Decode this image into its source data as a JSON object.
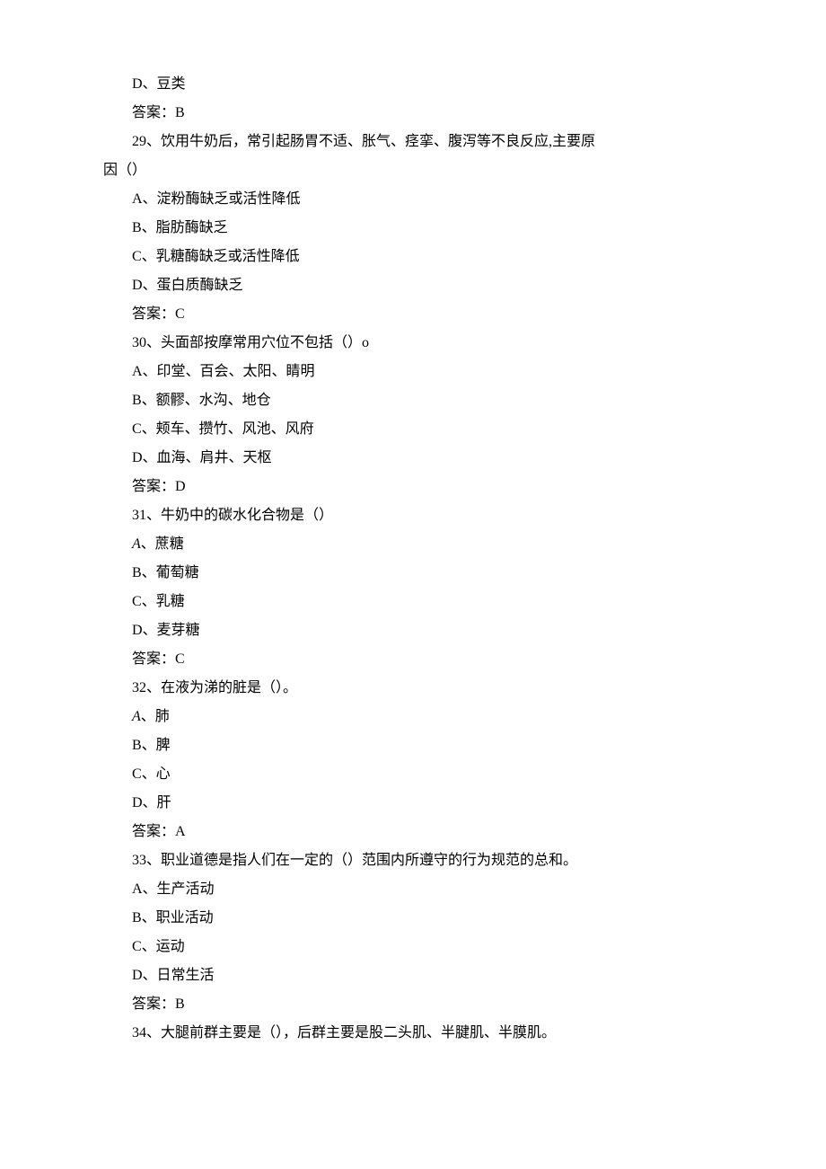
{
  "lines": [
    "D、豆类",
    "答案：B",
    "29、饮用牛奶后，常引起肠胃不适、胀气、痉挛、腹泻等不良反应,主要原因（）",
    "A、淀粉酶缺乏或活性降低",
    "B、脂肪酶缺乏",
    "C、乳糖酶缺乏或活性降低",
    "D、蛋白质酶缺乏",
    "答案：C",
    "30、头面部按摩常用穴位不包括（）o",
    "A、印堂、百会、太阳、睛明",
    "B、额髎、水沟、地仓",
    "C、颊车、攒竹、风池、风府",
    "D、血海、肩井、天枢",
    "答案：D",
    "31、牛奶中的碳水化合物是（）",
    "A、蔗糖",
    "B、葡萄糖",
    "C、乳糖",
    "D、麦芽糖",
    "答案：C",
    "32、在液为涕的脏是（）。",
    "A、肺",
    "B、脾",
    "C、心",
    "D、肝",
    "答案：A",
    "33、职业道德是指人们在一定的（）范围内所遵守的行为规范的总和。",
    "A、生产活动",
    "B、职业活动",
    "C、运动",
    "D、日常生活",
    "答案：B",
    "34、大腿前群主要是（），后群主要是股二头肌、半腱肌、半膜肌。"
  ],
  "wrapIndex": 2,
  "wrapFirst": "29、饮用牛奶后，常引起肠胃不适、胀气、痉挛、腹泻等不良反应,主要原",
  "wrapSecond": "因（）",
  "italicAIndices": [
    15,
    21
  ]
}
